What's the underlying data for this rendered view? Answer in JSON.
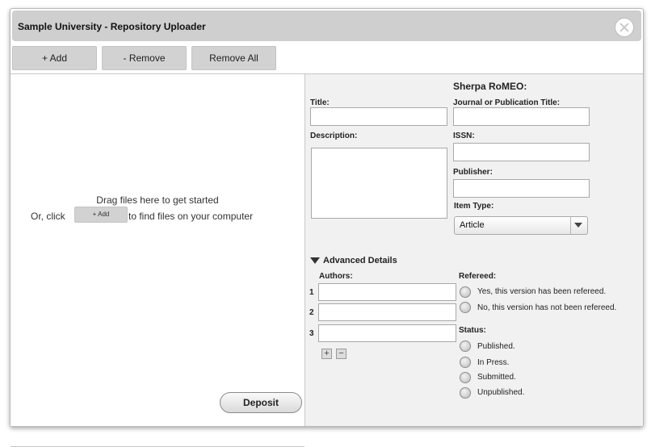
{
  "window": {
    "title": "Sample University - Repository Uploader"
  },
  "toolbar": {
    "add_label": "+ Add",
    "remove_label": "- Remove",
    "remove_all_label": "Remove All"
  },
  "dropzone": {
    "line1": "Drag files here to get started",
    "or_click": "Or, click",
    "add_label": "+ Add",
    "find_text": "to find files on your computer"
  },
  "deposit_label": "Deposit",
  "form": {
    "title_label": "Title:",
    "title_value": "",
    "description_label": "Description:",
    "description_value": ""
  },
  "romeo": {
    "header": "Sherpa RoMEO:",
    "journal_label": "Journal or Publication Title:",
    "journal_value": "",
    "issn_label": "ISSN:",
    "issn_value": "",
    "publisher_label": "Publisher:",
    "publisher_value": "",
    "item_type_label": "Item Type:",
    "item_type_selected": "Article"
  },
  "advanced": {
    "toggle_label": "Advanced Details",
    "authors_label": "Authors:",
    "authors": [
      {
        "num": "1",
        "value": ""
      },
      {
        "num": "2",
        "value": ""
      },
      {
        "num": "3",
        "value": ""
      }
    ],
    "add_author_label": "+",
    "remove_author_label": "−",
    "refereed_label": "Refereed:",
    "refereed_options": [
      "Yes, this version has been refereed.",
      "No, this version has not been refereed."
    ],
    "status_label": "Status:",
    "status_options": [
      "Published.",
      "In Press.",
      "Submitted.",
      "Unpublished."
    ]
  }
}
